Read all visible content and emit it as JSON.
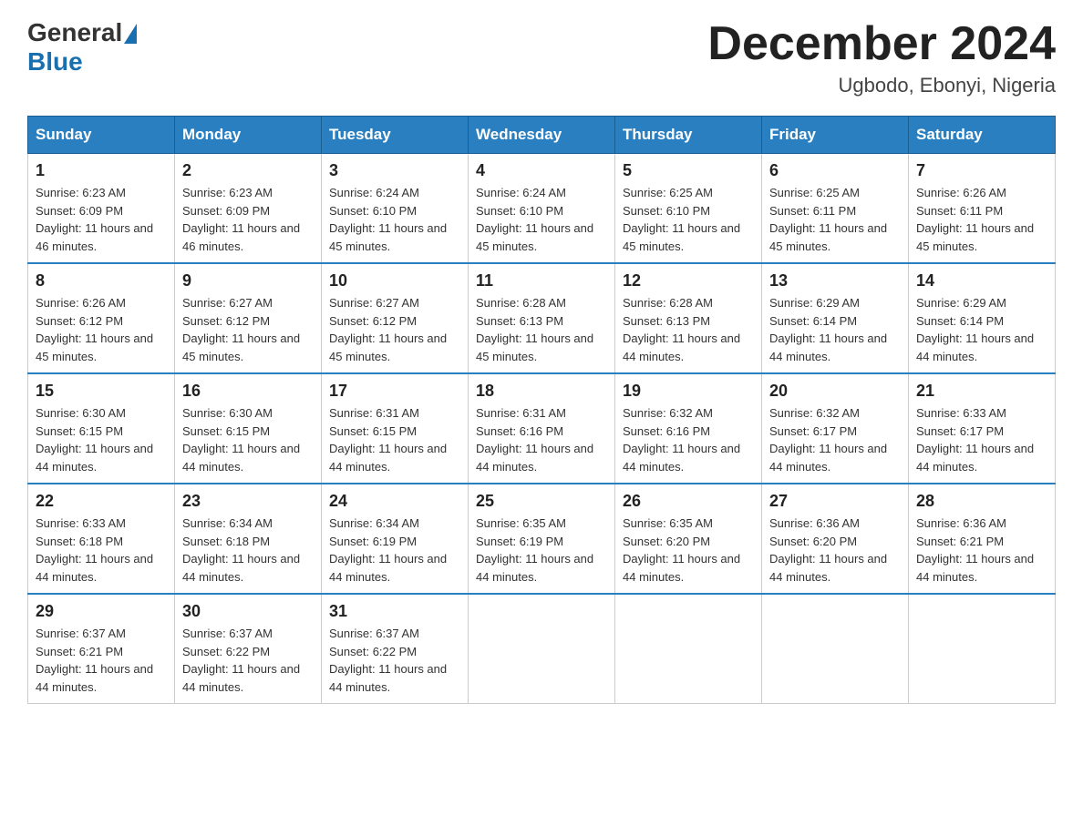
{
  "logo": {
    "text_general": "General",
    "text_blue": "Blue"
  },
  "title": "December 2024",
  "subtitle": "Ugbodo, Ebonyi, Nigeria",
  "days_of_week": [
    "Sunday",
    "Monday",
    "Tuesday",
    "Wednesday",
    "Thursday",
    "Friday",
    "Saturday"
  ],
  "weeks": [
    [
      {
        "day": "1",
        "sunrise": "6:23 AM",
        "sunset": "6:09 PM",
        "daylight": "11 hours and 46 minutes."
      },
      {
        "day": "2",
        "sunrise": "6:23 AM",
        "sunset": "6:09 PM",
        "daylight": "11 hours and 46 minutes."
      },
      {
        "day": "3",
        "sunrise": "6:24 AM",
        "sunset": "6:10 PM",
        "daylight": "11 hours and 45 minutes."
      },
      {
        "day": "4",
        "sunrise": "6:24 AM",
        "sunset": "6:10 PM",
        "daylight": "11 hours and 45 minutes."
      },
      {
        "day": "5",
        "sunrise": "6:25 AM",
        "sunset": "6:10 PM",
        "daylight": "11 hours and 45 minutes."
      },
      {
        "day": "6",
        "sunrise": "6:25 AM",
        "sunset": "6:11 PM",
        "daylight": "11 hours and 45 minutes."
      },
      {
        "day": "7",
        "sunrise": "6:26 AM",
        "sunset": "6:11 PM",
        "daylight": "11 hours and 45 minutes."
      }
    ],
    [
      {
        "day": "8",
        "sunrise": "6:26 AM",
        "sunset": "6:12 PM",
        "daylight": "11 hours and 45 minutes."
      },
      {
        "day": "9",
        "sunrise": "6:27 AM",
        "sunset": "6:12 PM",
        "daylight": "11 hours and 45 minutes."
      },
      {
        "day": "10",
        "sunrise": "6:27 AM",
        "sunset": "6:12 PM",
        "daylight": "11 hours and 45 minutes."
      },
      {
        "day": "11",
        "sunrise": "6:28 AM",
        "sunset": "6:13 PM",
        "daylight": "11 hours and 45 minutes."
      },
      {
        "day": "12",
        "sunrise": "6:28 AM",
        "sunset": "6:13 PM",
        "daylight": "11 hours and 44 minutes."
      },
      {
        "day": "13",
        "sunrise": "6:29 AM",
        "sunset": "6:14 PM",
        "daylight": "11 hours and 44 minutes."
      },
      {
        "day": "14",
        "sunrise": "6:29 AM",
        "sunset": "6:14 PM",
        "daylight": "11 hours and 44 minutes."
      }
    ],
    [
      {
        "day": "15",
        "sunrise": "6:30 AM",
        "sunset": "6:15 PM",
        "daylight": "11 hours and 44 minutes."
      },
      {
        "day": "16",
        "sunrise": "6:30 AM",
        "sunset": "6:15 PM",
        "daylight": "11 hours and 44 minutes."
      },
      {
        "day": "17",
        "sunrise": "6:31 AM",
        "sunset": "6:15 PM",
        "daylight": "11 hours and 44 minutes."
      },
      {
        "day": "18",
        "sunrise": "6:31 AM",
        "sunset": "6:16 PM",
        "daylight": "11 hours and 44 minutes."
      },
      {
        "day": "19",
        "sunrise": "6:32 AM",
        "sunset": "6:16 PM",
        "daylight": "11 hours and 44 minutes."
      },
      {
        "day": "20",
        "sunrise": "6:32 AM",
        "sunset": "6:17 PM",
        "daylight": "11 hours and 44 minutes."
      },
      {
        "day": "21",
        "sunrise": "6:33 AM",
        "sunset": "6:17 PM",
        "daylight": "11 hours and 44 minutes."
      }
    ],
    [
      {
        "day": "22",
        "sunrise": "6:33 AM",
        "sunset": "6:18 PM",
        "daylight": "11 hours and 44 minutes."
      },
      {
        "day": "23",
        "sunrise": "6:34 AM",
        "sunset": "6:18 PM",
        "daylight": "11 hours and 44 minutes."
      },
      {
        "day": "24",
        "sunrise": "6:34 AM",
        "sunset": "6:19 PM",
        "daylight": "11 hours and 44 minutes."
      },
      {
        "day": "25",
        "sunrise": "6:35 AM",
        "sunset": "6:19 PM",
        "daylight": "11 hours and 44 minutes."
      },
      {
        "day": "26",
        "sunrise": "6:35 AM",
        "sunset": "6:20 PM",
        "daylight": "11 hours and 44 minutes."
      },
      {
        "day": "27",
        "sunrise": "6:36 AM",
        "sunset": "6:20 PM",
        "daylight": "11 hours and 44 minutes."
      },
      {
        "day": "28",
        "sunrise": "6:36 AM",
        "sunset": "6:21 PM",
        "daylight": "11 hours and 44 minutes."
      }
    ],
    [
      {
        "day": "29",
        "sunrise": "6:37 AM",
        "sunset": "6:21 PM",
        "daylight": "11 hours and 44 minutes."
      },
      {
        "day": "30",
        "sunrise": "6:37 AM",
        "sunset": "6:22 PM",
        "daylight": "11 hours and 44 minutes."
      },
      {
        "day": "31",
        "sunrise": "6:37 AM",
        "sunset": "6:22 PM",
        "daylight": "11 hours and 44 minutes."
      },
      null,
      null,
      null,
      null
    ]
  ],
  "labels": {
    "sunrise": "Sunrise:",
    "sunset": "Sunset:",
    "daylight": "Daylight:"
  }
}
